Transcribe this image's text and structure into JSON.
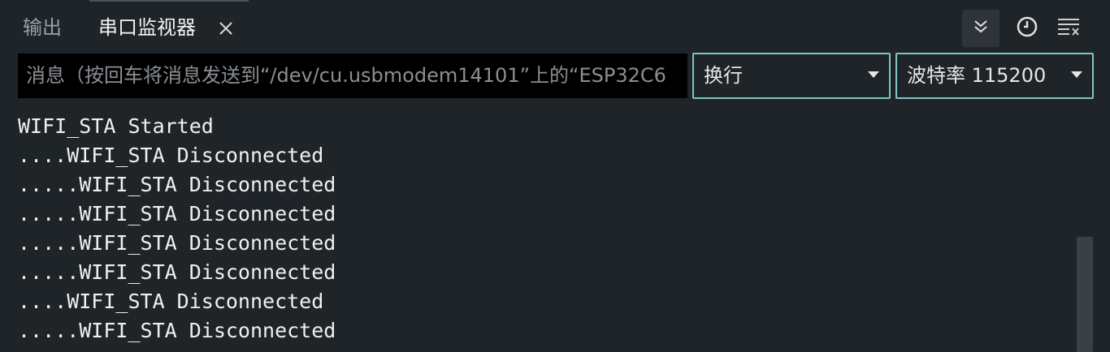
{
  "tabs": {
    "output_label": "输出",
    "monitor_label": "串口监视器"
  },
  "input": {
    "placeholder": "消息（按回车将消息发送到“/dev/cu.usbmodem14101”上的“ESP32C6"
  },
  "line_ending": {
    "selected": "换行"
  },
  "baud": {
    "selected": "波特率 115200"
  },
  "output_lines": [
    "WIFI_STA Started",
    "....WIFI_STA Disconnected",
    ".....WIFI_STA Disconnected",
    ".....WIFI_STA Disconnected",
    ".....WIFI_STA Disconnected",
    ".....WIFI_STA Disconnected",
    "....WIFI_STA Disconnected",
    ".....WIFI_STA Disconnected"
  ],
  "icons": {
    "close": "close-icon",
    "autoscroll": "double-chevron-down-icon",
    "timestamp": "clock-icon",
    "clear": "clear-output-icon",
    "dropdown": "chevron-down-icon"
  },
  "colors": {
    "background": "#1f2428",
    "input_background": "#000000",
    "select_border": "#7fc4c4",
    "text": "#f0f0f0",
    "muted_text": "#9aa0a6"
  }
}
